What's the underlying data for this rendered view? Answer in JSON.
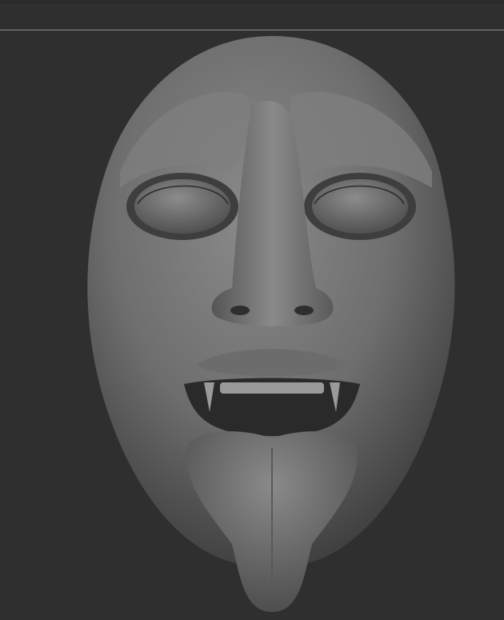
{
  "viewport": {
    "background": "#2f2f2f",
    "divider_color": "#8c8c8c",
    "model": {
      "icon": "sculpted-head-model",
      "base_color": "#7a7a7a"
    }
  }
}
